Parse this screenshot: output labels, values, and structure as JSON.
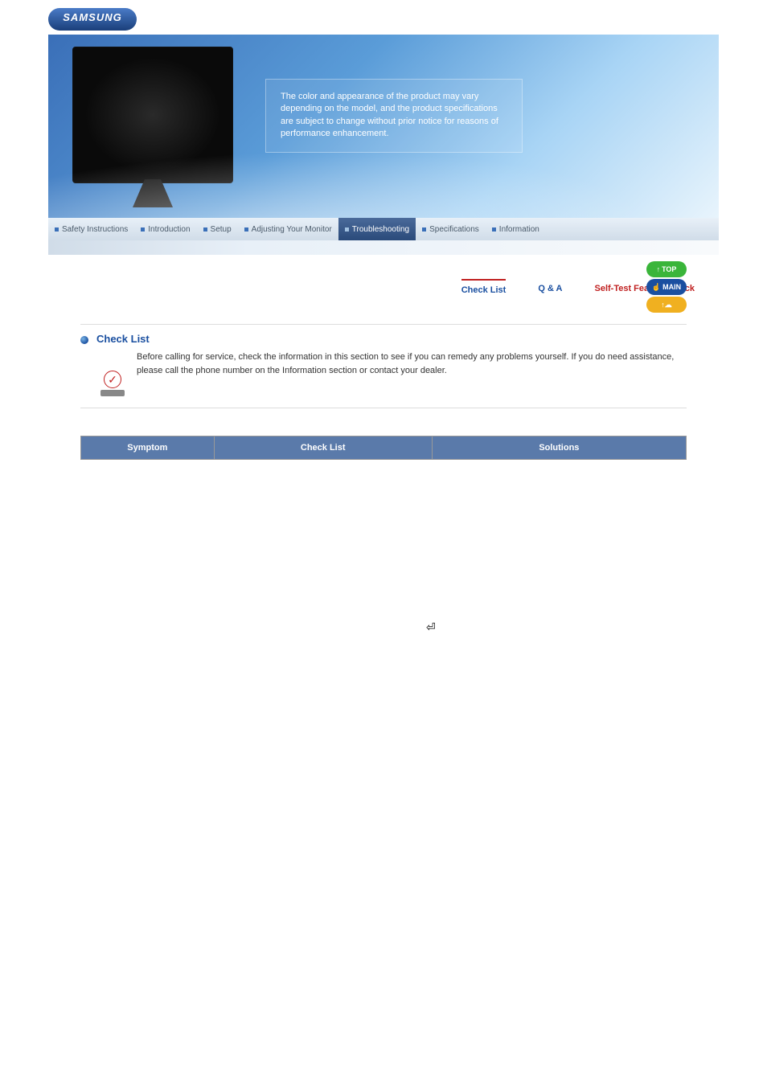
{
  "brand": "SAMSUNG",
  "hero": {
    "notice": "The color and appearance of the product may vary depending on the model, and the product specifications are subject to change without prior notice for reasons of performance enhancement."
  },
  "nav": {
    "items": [
      {
        "label": "Safety Instructions",
        "active": false
      },
      {
        "label": "Introduction",
        "active": false
      },
      {
        "label": "Setup",
        "active": false
      },
      {
        "label": "Adjusting Your Monitor",
        "active": false
      },
      {
        "label": "Troubleshooting",
        "active": true
      },
      {
        "label": "Specifications",
        "active": false
      },
      {
        "label": "Information",
        "active": false
      }
    ]
  },
  "side_buttons": {
    "top": "TOP",
    "main": "MAIN"
  },
  "sub_tabs": {
    "items": [
      {
        "label": "Check List",
        "active": true,
        "color": "blue"
      },
      {
        "label": "Q & A",
        "active": false,
        "color": "blue"
      },
      {
        "label": "Self-Test Feature Check",
        "active": false,
        "color": "red"
      }
    ]
  },
  "checklist": {
    "title": "Check List",
    "note": "Before calling for service, check the information in this section to see if you can remedy any problems yourself. If you do need assistance, please call the phone number on the Information section or contact your dealer.",
    "table": {
      "headers": [
        "Symptom",
        "Check List",
        "Solutions"
      ]
    }
  }
}
